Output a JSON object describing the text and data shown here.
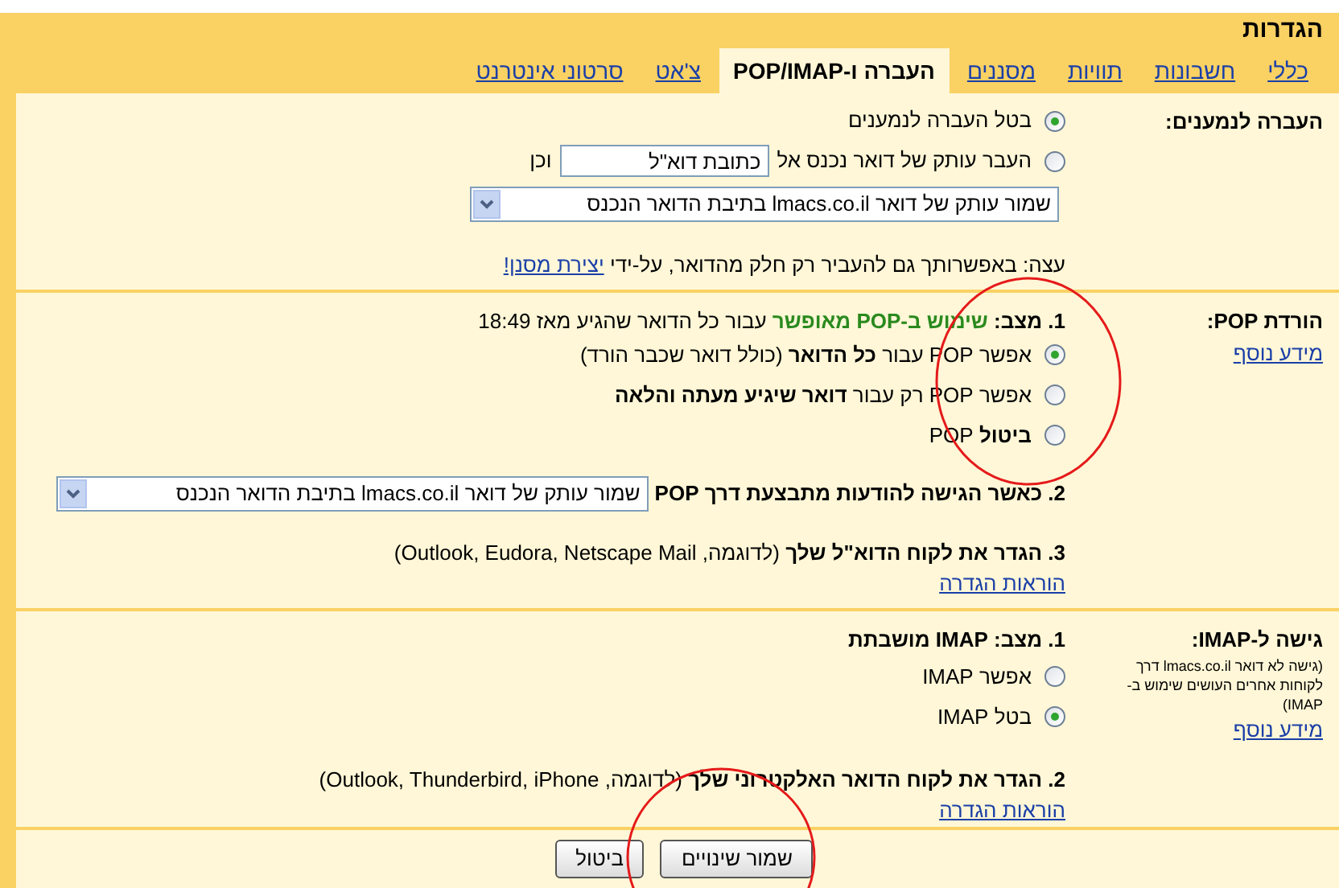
{
  "title": "הגדרות",
  "tabs": [
    {
      "label": "כללי",
      "selected": false
    },
    {
      "label": "חשבונות",
      "selected": false
    },
    {
      "label": "תוויות",
      "selected": false
    },
    {
      "label": "מסננים",
      "selected": false
    },
    {
      "label": "העברה ו-POP/IMAP",
      "selected": true
    },
    {
      "label": "צ'אט",
      "selected": false
    },
    {
      "label": "סרטוני אינטרנט",
      "selected": false
    }
  ],
  "forwarding": {
    "label": "העברה לנמענים:",
    "options": [
      {
        "text": "בטל העברה לנמענים",
        "selected": true
      },
      {
        "text": "העבר עותק של דואר נכנס אל",
        "selected": false
      }
    ],
    "address_field": {
      "value": "כתובת דוא\"ל"
    },
    "and_text": "וכן",
    "keep_select": "שמור עותק של דואר lmacs.co.il בתיבת הדואר הנכנס",
    "tip": "עצה: באפשרותך גם להעביר רק חלק מהדואר, על-ידי",
    "tip_link": "יצירת מסנן!"
  },
  "pop": {
    "label": "הורדת POP:",
    "more_link": "מידע נוסף",
    "status": {
      "prefix": "1. מצב:",
      "state": "שימוש ב-POP מאופשר",
      "rest": "עבור כל הדואר שהגיע מאז 18:49"
    },
    "options": [
      {
        "text": "אפשר POP עבור **כל הדואר** (כולל דואר שכבר הורד)",
        "selected": true
      },
      {
        "text": "אפשר POP רק עבור **דואר שיגיע מעתה והלאה**",
        "selected": false
      },
      {
        "text": "**ביטול** POP",
        "selected": false
      }
    ],
    "when_label": "2. כאשר הגישה להודעות מתבצעת דרך POP",
    "when_select": "שמור עותק של דואר lmacs.co.il בתיבת הדואר הנכנס",
    "setup": "**3. הגדר את לקוח הדוא\"ל שלך** (לדוגמה, Outlook, Eudora, Netscape Mail)",
    "setup_link": "הוראות הגדרה"
  },
  "imap": {
    "label": "גישה ל-IMAP:",
    "note": "(גישה לא דואר lmacs.co.il דרך לקוחות אחרים העושים שימוש ב-IMAP)",
    "more_link": "מידע נוסף",
    "status": "1. מצב: IMAP מושבתת",
    "options": [
      {
        "text": "אפשר IMAP",
        "selected": false
      },
      {
        "text": "בטל IMAP",
        "selected": true
      }
    ],
    "setup": "**2. הגדר את לקוח הדואר האלקטרוני שלך** (לדוגמה, Outlook, Thunderbird, iPhone)",
    "setup_link": "הוראות הגדרה"
  },
  "buttons": [
    "שמור שינויים",
    "ביטול"
  ]
}
